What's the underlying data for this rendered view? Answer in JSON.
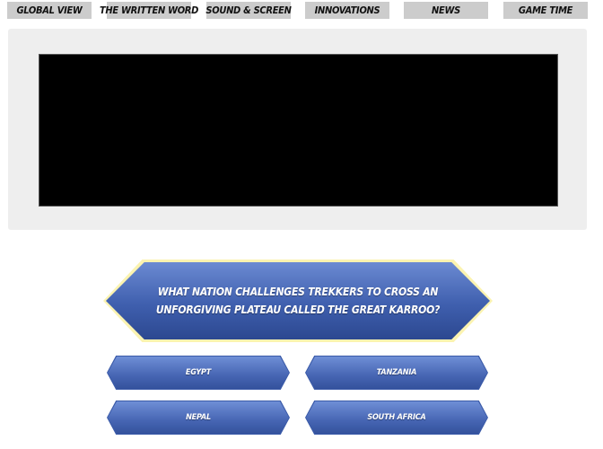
{
  "nav": {
    "tabs": [
      {
        "label": "GLOBAL VIEW"
      },
      {
        "label": "THE WRITTEN WORD"
      },
      {
        "label": "SOUND & SCREEN"
      },
      {
        "label": "INNOVATIONS"
      },
      {
        "label": "NEWS"
      },
      {
        "label": "GAME TIME"
      }
    ]
  },
  "quiz": {
    "question": "WHAT NATION CHALLENGES TREKKERS TO CROSS AN UNFORGIVING PLATEAU CALLED THE GREAT KARROO?",
    "answers": [
      {
        "label": "EGYPT"
      },
      {
        "label": "TANZANIA"
      },
      {
        "label": "NEPAL"
      },
      {
        "label": "SOUTH AFRICA"
      }
    ]
  },
  "colors": {
    "tab_bg": "#cccccc",
    "panel_bg": "#eeeeee",
    "player_bg": "#000000",
    "question_glow": "#fbf3b0",
    "button_blue": "#4665b3"
  }
}
